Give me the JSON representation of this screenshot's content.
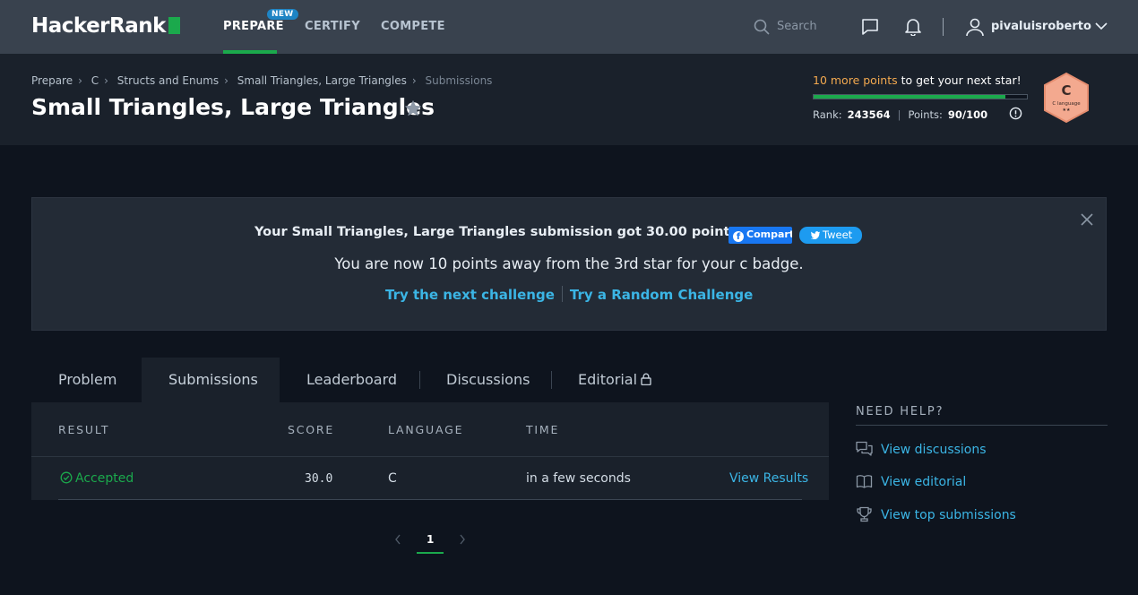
{
  "nav": {
    "logo": "HackerRank",
    "links": [
      "PREPARE",
      "CERTIFY",
      "COMPETE"
    ],
    "new_badge": "NEW",
    "search_placeholder": "Search",
    "username": "pivaluisroberto"
  },
  "header": {
    "breadcrumb": [
      "Prepare",
      "C",
      "Structs and Enums",
      "Small Triangles, Large Triangles",
      "Submissions"
    ],
    "title": "Small Triangles, Large Triangles",
    "points_highlight": "10 more points",
    "points_rest": " to get your next star!",
    "progress_fraction": 0.9,
    "rank_label": "Rank:",
    "rank_value": "243564",
    "points_label": "Points:",
    "points_value": "90/100",
    "badge_letter": "C",
    "badge_caption": "C language",
    "badge_stars": "★★"
  },
  "banner": {
    "title": "Your Small Triangles, Large Triangles submission got 30.00 points.",
    "fb_label": "Compart",
    "tweet_label": "Tweet",
    "subtitle": "You are now 10 points away from the 3rd star for your c badge.",
    "link_next": "Try the next challenge",
    "link_random": "Try a Random Challenge"
  },
  "tabs": [
    "Problem",
    "Submissions",
    "Leaderboard",
    "Discussions",
    "Editorial"
  ],
  "table": {
    "headers": [
      "RESULT",
      "SCORE",
      "LANGUAGE",
      "TIME"
    ],
    "rows": [
      {
        "result": "Accepted",
        "score": "30.0",
        "language": "C",
        "time": "in a few seconds",
        "action": "View Results"
      }
    ]
  },
  "pagination": {
    "current": "1"
  },
  "help": {
    "title": "NEED HELP?",
    "items": [
      "View discussions",
      "View editorial",
      "View top submissions"
    ]
  },
  "colors": {
    "accent": "#1ba94c",
    "link": "#3bb5e5",
    "nav_bg": "#39424e",
    "page_bg": "#0e141e"
  }
}
